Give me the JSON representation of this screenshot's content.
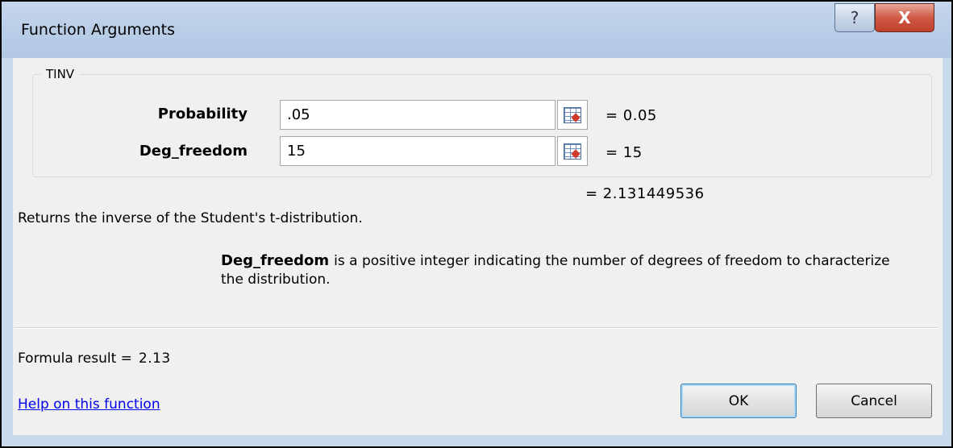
{
  "window": {
    "title": "Function Arguments",
    "help_button": "?",
    "close_button": "X"
  },
  "function": {
    "name": "TINV",
    "description": "Returns the inverse of the Student's t-distribution.",
    "result": "= 2.131449536"
  },
  "arguments": [
    {
      "label": "Probability",
      "value": ".05",
      "evaluated": "= 0.05"
    },
    {
      "label": "Deg_freedom",
      "value": "15",
      "evaluated": "= 15"
    }
  ],
  "argument_help": {
    "name": "Deg_freedom",
    "text": "is a positive integer indicating the number of degrees of freedom to characterize the distribution."
  },
  "formula_result": {
    "label": "Formula result =",
    "value": "2.13"
  },
  "footer": {
    "help_link": "Help on this function",
    "ok_label": "OK",
    "cancel_label": "Cancel"
  }
}
